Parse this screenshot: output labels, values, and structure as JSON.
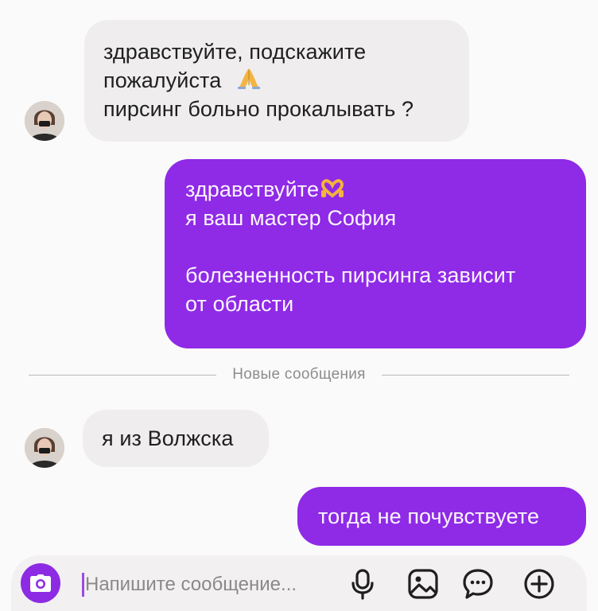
{
  "messages": [
    {
      "direction": "incoming",
      "lines": [
        "здравствуйте, подскажите",
        "пожалуйста",
        "пирсинг больно прокалывать ?"
      ],
      "emoji": "praying-hands"
    },
    {
      "direction": "outgoing",
      "lines": [
        "здравствуйте",
        "я ваш мастер София",
        "",
        "болезненность пирсинга зависит",
        "от области"
      ],
      "emoji": "heart-hands"
    },
    {
      "direction": "incoming",
      "lines": [
        "я из Волжска"
      ]
    },
    {
      "direction": "outgoing",
      "lines": [
        "тогда не почувствуете"
      ]
    }
  ],
  "divider": {
    "label": "Новые сообщения"
  },
  "composer": {
    "placeholder": "Напишите сообщение...",
    "icons": [
      "camera-icon",
      "microphone-icon",
      "gallery-icon",
      "sticker-icon",
      "plus-icon"
    ]
  },
  "colors": {
    "outgoing_bubble": "#8f2ae6",
    "incoming_bubble": "#efedee",
    "accent": "#8c2be3",
    "background": "#fbfafa"
  }
}
